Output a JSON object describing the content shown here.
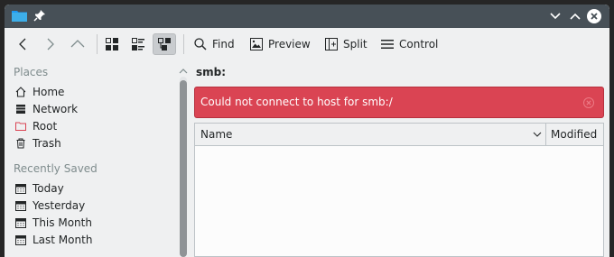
{
  "toolbar": {
    "find_label": "Find",
    "preview_label": "Preview",
    "split_label": "Split",
    "control_label": "Control"
  },
  "sidebar": {
    "places_heading": "Places",
    "places": [
      {
        "label": "Home",
        "icon": "home-icon"
      },
      {
        "label": "Network",
        "icon": "network-icon"
      },
      {
        "label": "Root",
        "icon": "root-folder-icon"
      },
      {
        "label": "Trash",
        "icon": "trash-icon"
      }
    ],
    "recent_heading": "Recently Saved",
    "recent": [
      {
        "label": "Today",
        "icon": "calendar-icon"
      },
      {
        "label": "Yesterday",
        "icon": "calendar-icon"
      },
      {
        "label": "This Month",
        "icon": "calendar-icon"
      },
      {
        "label": "Last Month",
        "icon": "calendar-icon"
      }
    ]
  },
  "main": {
    "path": "smb:",
    "error_message": "Could not connect to host for smb:/",
    "columns": {
      "name": "Name",
      "modified": "Modified"
    }
  },
  "colors": {
    "titlebar": "#475057",
    "window_bg": "#eff0f1",
    "error_bg": "#da4453",
    "text": "#232627",
    "muted": "#7f8c8d"
  }
}
